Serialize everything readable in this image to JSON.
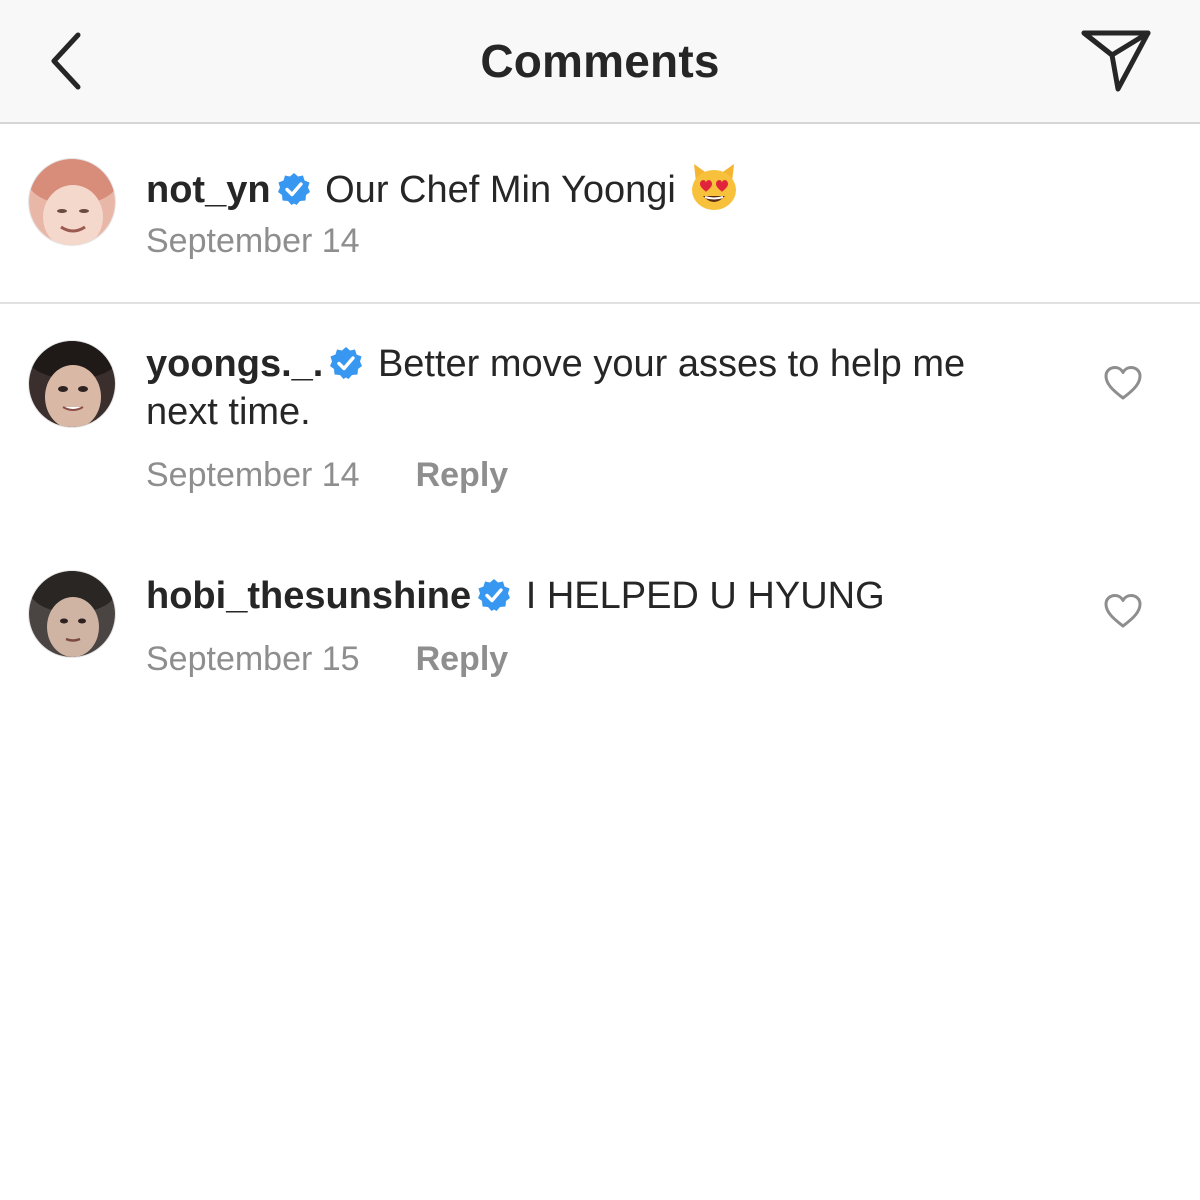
{
  "header": {
    "title": "Comments",
    "back_icon": "chevron-left-icon",
    "share_icon": "paper-plane-icon"
  },
  "caption": {
    "username": "not_yn",
    "verified": true,
    "text": "Our Chef Min Yoongi",
    "emoji": "heart-eyes-cat-emoji",
    "date": "September 14"
  },
  "comments": [
    {
      "username": "yoongs._.",
      "verified": true,
      "text": "Better move your asses to help me next time.",
      "date": "September 14",
      "reply_label": "Reply"
    },
    {
      "username": "hobi_thesunshine",
      "verified": true,
      "text": "I HELPED U HYUNG",
      "date": "September 15",
      "reply_label": "Reply"
    }
  ],
  "colors": {
    "text": "#262626",
    "secondary": "#8e8e8e",
    "verified_blue": "#3897f0",
    "header_bg": "#f8f8f8"
  }
}
